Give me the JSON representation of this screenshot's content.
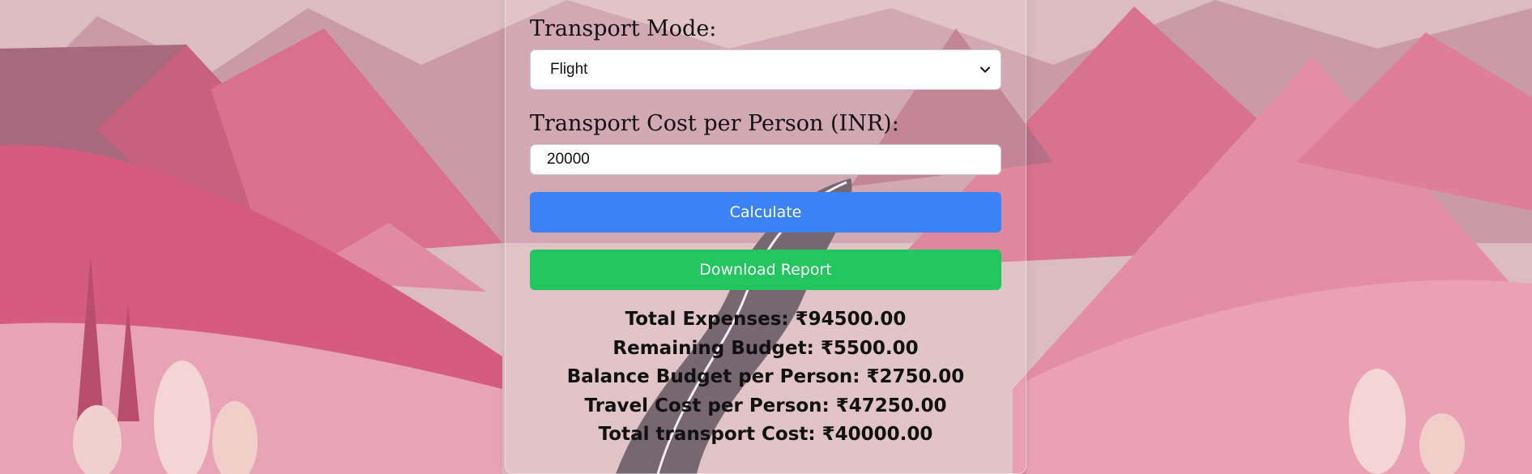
{
  "form": {
    "transport_mode_label": "Transport Mode:",
    "transport_mode_value": "Flight",
    "transport_cost_label": "Transport Cost per Person (INR):",
    "transport_cost_value": "20000"
  },
  "buttons": {
    "calculate_label": "Calculate",
    "download_label": "Download Report"
  },
  "results": {
    "total_expenses": "Total Expenses: ₹94500.00",
    "remaining_budget": "Remaining Budget: ₹5500.00",
    "balance_per_person": "Balance Budget per Person: ₹2750.00",
    "travel_cost_per_person": "Travel Cost per Person: ₹47250.00",
    "total_transport_cost": "Total transport Cost: ₹40000.00"
  },
  "colors": {
    "calculate_button": "#3b82f6",
    "download_button": "#22c55e",
    "background_pink": "#d98ca2"
  },
  "icons": {
    "select_arrow": "chevron-down-icon",
    "background": "pink-mountains-road-illustration"
  }
}
